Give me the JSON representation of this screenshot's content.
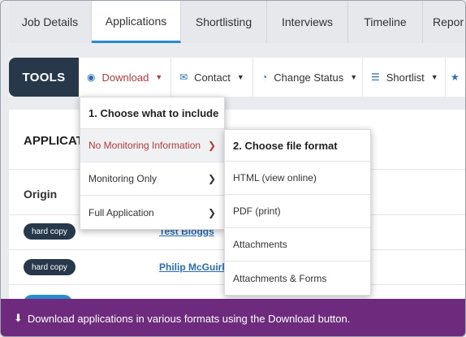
{
  "tabs": [
    {
      "label": "Job Details"
    },
    {
      "label": "Applications"
    },
    {
      "label": "Shortlisting"
    },
    {
      "label": "Interviews"
    },
    {
      "label": "Timeline"
    },
    {
      "label": "Repor"
    }
  ],
  "toolbar": {
    "label": "TOOLS",
    "download": "Download",
    "contact": "Contact",
    "change_status": "Change Status",
    "shortlist": "Shortlist"
  },
  "card": {
    "title": "APPLICAT",
    "origin_header": "Origin",
    "rows": [
      {
        "origin": "hard copy",
        "name": "Test Bloggs"
      },
      {
        "origin": "hard copy",
        "name": "Philip McGuirk"
      }
    ]
  },
  "menu1": {
    "heading": "1. Choose what to include",
    "items": [
      "No Monitoring Information",
      "Monitoring Only",
      "Full Application"
    ]
  },
  "menu2": {
    "heading": "2. Choose file format",
    "items": [
      "HTML (view online)",
      "PDF (print)",
      "Attachments",
      "Attachments & Forms"
    ]
  },
  "banner": {
    "text": "Download applications in various formats using the Download button."
  },
  "colors": {
    "accent": "#2a8ccf",
    "dark": "#263849",
    "highlight": "#b83a3a",
    "banner": "#6e2b7e"
  }
}
